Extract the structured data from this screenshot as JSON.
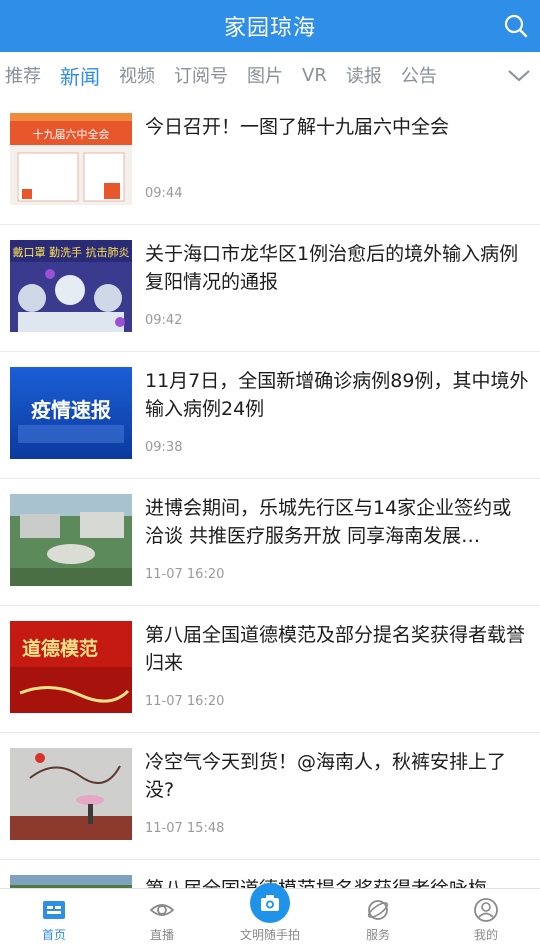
{
  "header": {
    "title": "家园琼海"
  },
  "tabs": [
    {
      "label": "推荐"
    },
    {
      "label": "新闻"
    },
    {
      "label": "视频"
    },
    {
      "label": "订阅号"
    },
    {
      "label": "图片"
    },
    {
      "label": "VR"
    },
    {
      "label": "读报"
    },
    {
      "label": "公告"
    }
  ],
  "active_tab": "新闻",
  "news": [
    {
      "title": "今日召开！一图了解十九届六中全会",
      "time": "09:44",
      "thumb_text": "十九届六中全会"
    },
    {
      "title": "关于海口市龙华区1例治愈后的境外输入病例复阳情况的通报",
      "time": "09:42",
      "thumb_text": "戴口罩 勤洗手 抗击肺炎"
    },
    {
      "title": "11月7日，全国新增确诊病例89例，其中境外输入病例24例",
      "time": "09:38",
      "thumb_text": "疫情速报"
    },
    {
      "title": "进博会期间，乐城先行区与14家企业签约或洽谈 共推医疗服务开放 同享海南发展…",
      "time": "11-07 16:20",
      "thumb_text": ""
    },
    {
      "title": "第八届全国道德模范及部分提名奖获得者载誉归来",
      "time": "11-07 16:20",
      "thumb_text": "道德模范"
    },
    {
      "title": "冷空气今天到货！@海南人，秋裤安排上了没?",
      "time": "11-07 15:48",
      "thumb_text": ""
    },
    {
      "title": "第八届全国道德模范提名奖获得者徐咏梅",
      "time": "",
      "thumb_text": ""
    }
  ],
  "bottom_nav": [
    {
      "label": "首页",
      "icon": "home-icon"
    },
    {
      "label": "直播",
      "icon": "eye-icon"
    },
    {
      "label": "文明随手拍",
      "icon": "camera-icon"
    },
    {
      "label": "服务",
      "icon": "service-icon"
    },
    {
      "label": "我的",
      "icon": "user-icon"
    }
  ],
  "colors": {
    "brand": "#2f8ee8",
    "tab_inactive": "#8a8f99"
  }
}
